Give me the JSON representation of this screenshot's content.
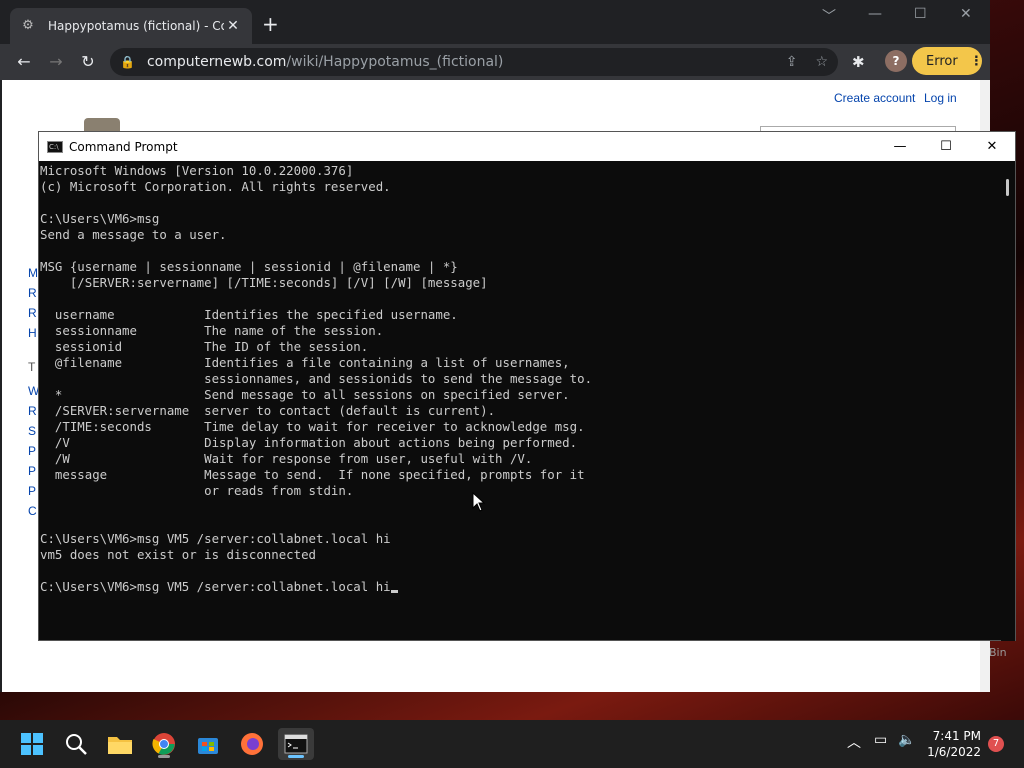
{
  "browser": {
    "tab_title": "Happypotamus (fictional) - Comp",
    "tab_close": "✕",
    "new_tab": "+",
    "window_controls": [
      "﹀",
      "—",
      "☐",
      "✕"
    ],
    "url_domain": "computernewb.com",
    "url_path": "/wiki/Happypotamus_(fictional)",
    "profile_initial": "?",
    "error_label": "Error",
    "icons": [
      "back-icon",
      "forward-icon",
      "reload-icon",
      "lock-icon",
      "share-icon",
      "star-icon",
      "puzzle-icon"
    ]
  },
  "wiki": {
    "create_account": "Create account",
    "log_in": "Log in",
    "left_letters": [
      "M",
      "R",
      "R",
      "H",
      "T",
      "W",
      "R",
      "S",
      "P",
      "P",
      "P",
      "C"
    ],
    "bin_text": "Bin"
  },
  "cmd": {
    "title": "Command Prompt",
    "controls": [
      "—",
      "☐",
      "✕"
    ],
    "lines": [
      "Microsoft Windows [Version 10.0.22000.376]",
      "(c) Microsoft Corporation. All rights reserved.",
      "",
      "C:\\Users\\VM6>msg",
      "Send a message to a user.",
      "",
      "MSG {username | sessionname | sessionid | @filename | *}",
      "    [/SERVER:servername] [/TIME:seconds] [/V] [/W] [message]",
      "",
      "  username            Identifies the specified username.",
      "  sessionname         The name of the session.",
      "  sessionid           The ID of the session.",
      "  @filename           Identifies a file containing a list of usernames,",
      "                      sessionnames, and sessionids to send the message to.",
      "  *                   Send message to all sessions on specified server.",
      "  /SERVER:servername  server to contact (default is current).",
      "  /TIME:seconds       Time delay to wait for receiver to acknowledge msg.",
      "  /V                  Display information about actions being performed.",
      "  /W                  Wait for response from user, useful with /V.",
      "  message             Message to send.  If none specified, prompts for it",
      "                      or reads from stdin.",
      "",
      "",
      "C:\\Users\\VM6>msg VM5 /server:collabnet.local hi",
      "vm5 does not exist or is disconnected",
      ""
    ],
    "current_input": "C:\\Users\\VM6>msg VM5 /server:collabnet.local hi"
  },
  "taskbar": {
    "apps": [
      "start-icon",
      "search-icon",
      "file-explorer-icon",
      "chrome-icon",
      "store-icon",
      "firefox-icon",
      "terminal-icon"
    ],
    "time": "7:41 PM",
    "date": "1/6/2022",
    "notification_count": "7"
  }
}
